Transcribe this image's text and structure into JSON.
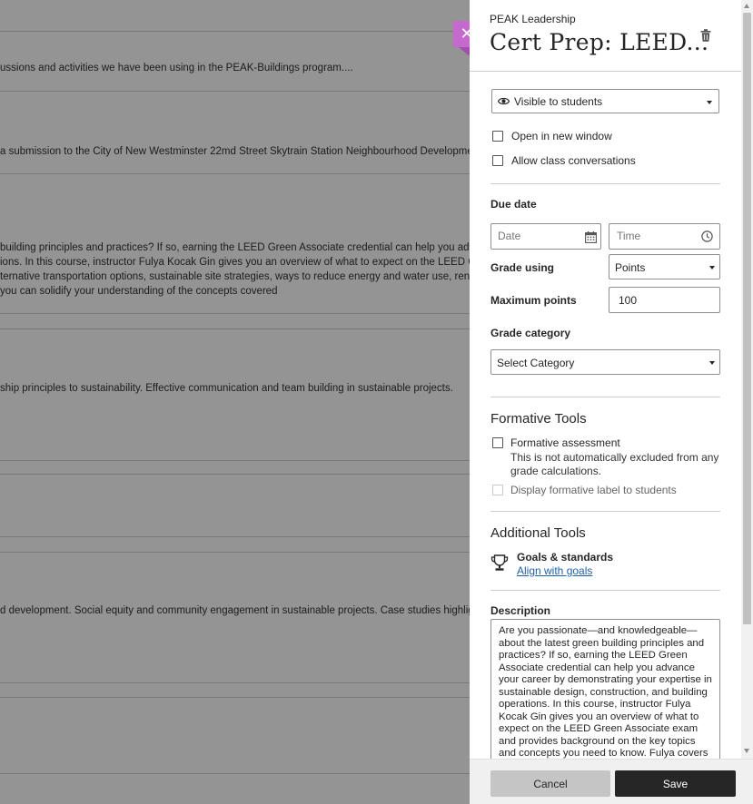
{
  "background": {
    "rows": [
      {
        "text": "ussions and activities we have been using in the PEAK-Buildings program...."
      },
      {
        "text": "a submission to the City of New Westminster 22md Street Skytrain Station Neighbourhood Development Ic"
      },
      {
        "text": "building principles and practices? If so, earning the LEED Green Associate credential can help you advance"
      },
      {
        "text": "ions. In this course, instructor Fulya Kocak Gin gives you an overview of what to expect on the LEED Green"
      },
      {
        "text": "ternative transportation options, sustainable site strategies, ways to reduce energy and water use, renewal"
      },
      {
        "text": "you can solidify your understanding of the concepts covered"
      },
      {
        "text": "ship principles to sustainability. Effective communication and team building in sustainable projects."
      },
      {
        "text": "d development. Social equity and community engagement in sustainable projects. Case studies highlightin"
      }
    ]
  },
  "close_button": {
    "glyph": "✕"
  },
  "panel": {
    "course_name": "PEAK Leadership",
    "title": "Cert Prep: LEED...",
    "visibility": {
      "value": "Visible to students"
    },
    "open_new_window": {
      "label": "Open in new window",
      "checked": false
    },
    "allow_conversations": {
      "label": "Allow class conversations",
      "checked": false
    },
    "due_date": {
      "label": "Due date",
      "date_placeholder": "Date",
      "time_placeholder": "Time"
    },
    "grade_using": {
      "label": "Grade using",
      "value": "Points"
    },
    "max_points": {
      "label": "Maximum points",
      "value": "100"
    },
    "grade_category": {
      "label": "Grade category",
      "value": "Select Category"
    },
    "formative": {
      "heading": "Formative Tools",
      "assessment_label": "Formative assessment",
      "assessment_note_1": "This is not automatically excluded from any",
      "assessment_note_2": "grade calculations.",
      "display_label": "Display formative label to students"
    },
    "additional": {
      "heading": "Additional Tools",
      "goals_title": "Goals & standards",
      "goals_link": "Align with goals"
    },
    "description": {
      "label": "Description",
      "text": "Are you passionate—and  knowledgeable—about the latest green building principles and practices? If so, earning the LEED Green Associate credential can help you advance your career by demonstrating your expertise in sustainable design, construction, and building operations. In this course, instructor Fulya Kocak Gin gives you an overview of what to expect on the LEED Green Associate exam and provides background on the key topics and concepts you need to know. Fulya covers"
    },
    "footer": {
      "cancel_label": "Cancel",
      "save_label": "Save"
    }
  },
  "colors": {
    "accent_purple": "#c569cf",
    "save_button": "#262626",
    "link": "#1f5fa8"
  }
}
